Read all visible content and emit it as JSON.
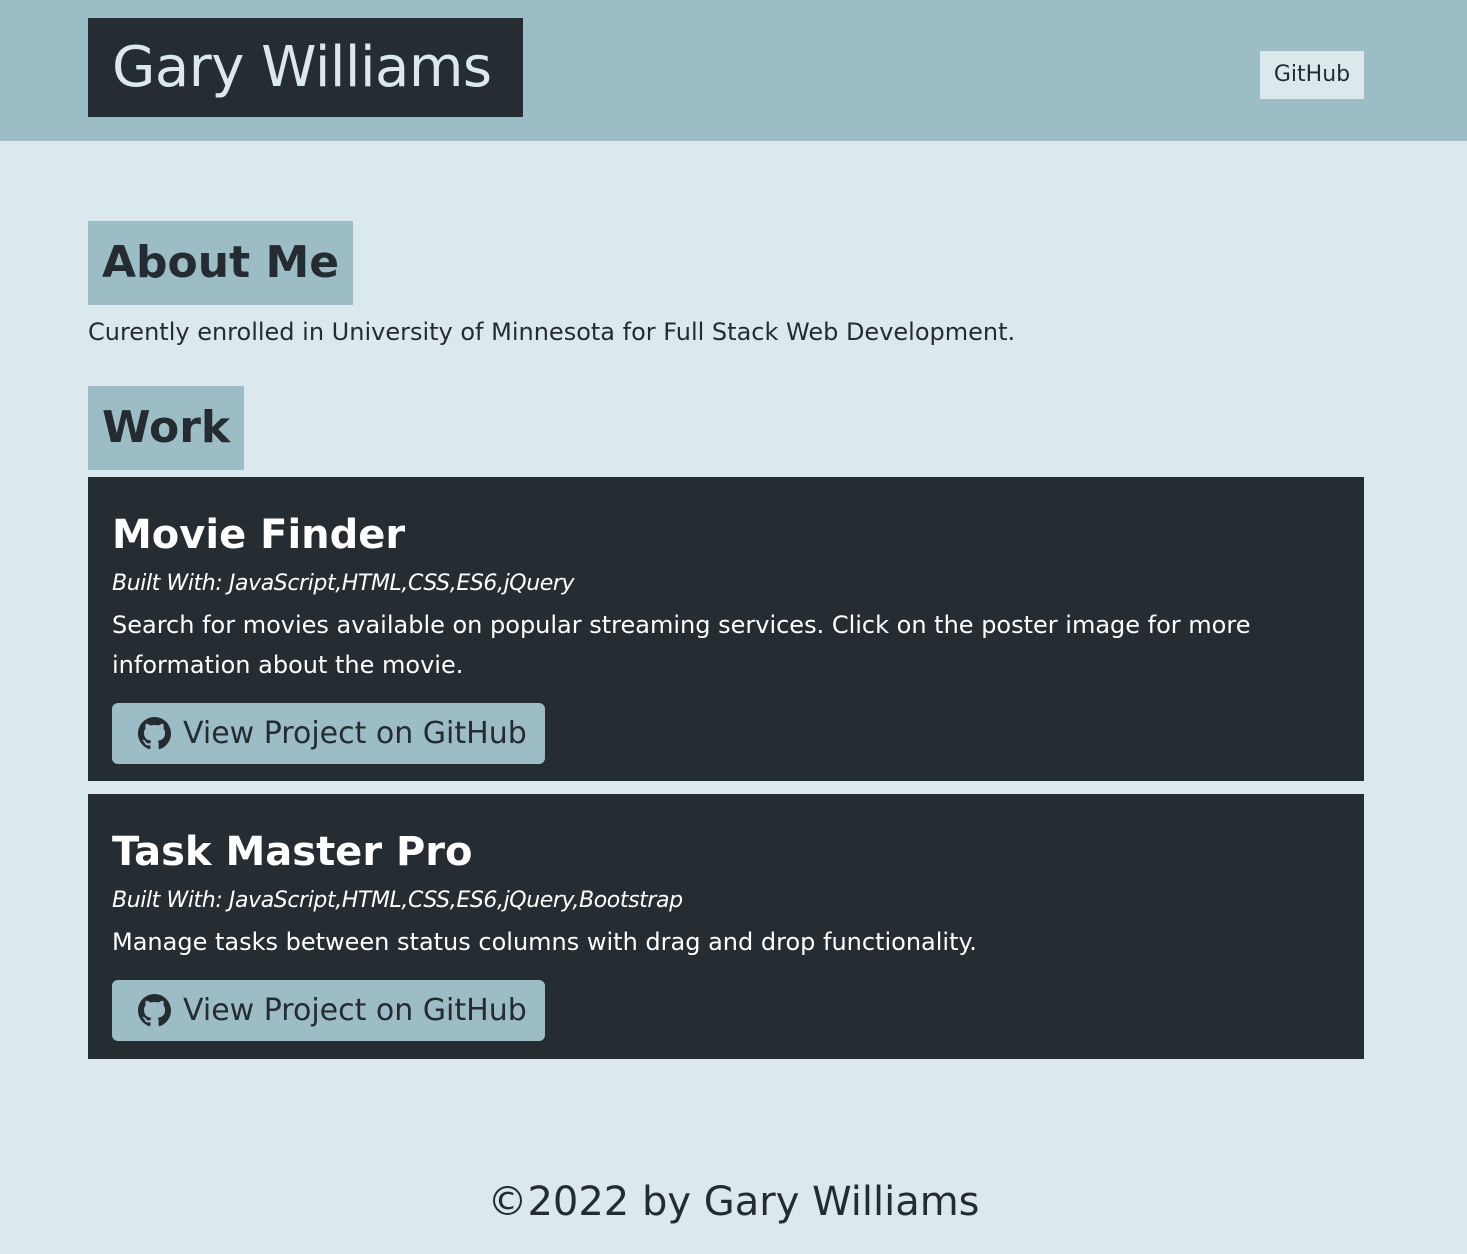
{
  "header": {
    "site_title": "Gary Williams",
    "nav_link": "GitHub"
  },
  "about": {
    "heading": "About Me",
    "text": "Curently enrolled in University of Minnesota for Full Stack Web Development."
  },
  "work": {
    "heading": "Work",
    "projects": [
      {
        "title": "Movie Finder",
        "tech": "Built With: JavaScript,HTML,CSS,ES6,jQuery",
        "description": "Search for movies available on popular streaming services. Click on the poster image for more information about the movie.",
        "button_label": "View Project on GitHub",
        "button_icon": "github-icon"
      },
      {
        "title": "Task Master Pro",
        "tech": "Built With: JavaScript,HTML,CSS,ES6,jQuery,Bootstrap",
        "description": "Manage tasks between status columns with drag and drop functionality.",
        "button_label": "View Project on GitHub",
        "button_icon": "github-icon"
      }
    ]
  },
  "footer": {
    "text": "©2022 by Gary Williams"
  },
  "colors": {
    "page_background": "#dbe9ed",
    "accent": "#9dbdc6",
    "dark": "#262d32",
    "text": "#252c31"
  }
}
